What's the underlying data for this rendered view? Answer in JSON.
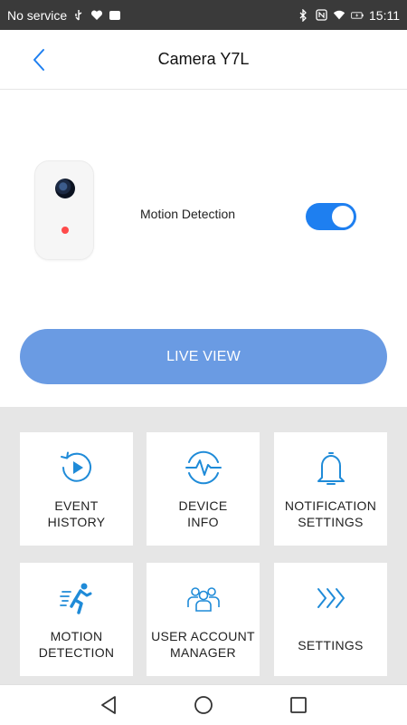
{
  "status_bar": {
    "carrier": "No service",
    "time": "15:11"
  },
  "app_bar": {
    "title": "Camera Y7L"
  },
  "device": {
    "motion_detection_label": "Motion Detection",
    "motion_detection_enabled": true
  },
  "live_view": {
    "label": "LIVE VIEW"
  },
  "tiles": [
    {
      "line1": "EVENT",
      "line2": "HISTORY",
      "icon": "event-history-icon"
    },
    {
      "line1": "DEVICE",
      "line2": "INFO",
      "icon": "device-info-icon"
    },
    {
      "line1": "NOTIFICATION",
      "line2": "SETTINGS",
      "icon": "bell-icon"
    },
    {
      "line1": "MOTION",
      "line2": "DETECTION",
      "icon": "running-person-icon"
    },
    {
      "line1": "USER ACCOUNT",
      "line2": "MANAGER",
      "icon": "user-group-icon"
    },
    {
      "line1": "SETTINGS",
      "line2": "",
      "icon": "chevrons-right-icon"
    }
  ],
  "colors": {
    "accent": "#1e7ff0",
    "live_view_bg": "#6a9be3",
    "icon_blue": "#1f8bd8"
  }
}
